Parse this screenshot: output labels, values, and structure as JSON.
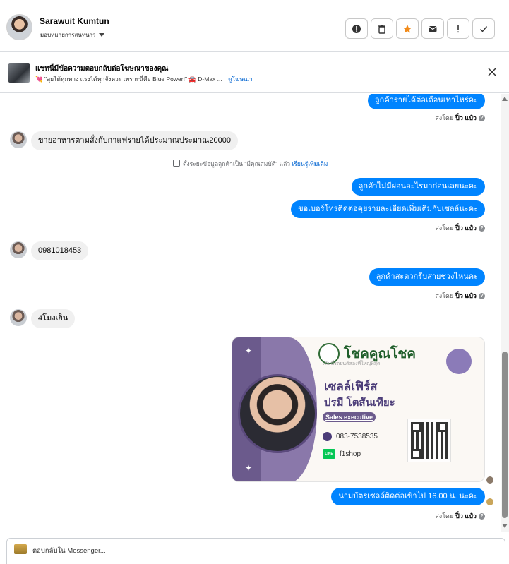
{
  "header": {
    "contact_name": "Sarawuit Kumtun",
    "assign_label": "มอบหมายการสนทนาว่"
  },
  "actions": [
    {
      "name": "spam-button",
      "icon": "alert-circle-icon"
    },
    {
      "name": "delete-button",
      "icon": "trash-icon"
    },
    {
      "name": "star-button",
      "icon": "star-icon"
    },
    {
      "name": "mark-unread-button",
      "icon": "envelope-icon"
    },
    {
      "name": "follow-up-button",
      "icon": "exclamation-icon"
    },
    {
      "name": "done-button",
      "icon": "check-icon"
    }
  ],
  "ad": {
    "title": "แชทนี้มีข้อความตอบกลับต่อโฆษณาของคุณ",
    "snippet": "💘 \"ลุยได้ทุกทาง แรงได้ทุกจังหวะ เพราะนี่คือ Blue Power!\" 🚘 D-Max ...",
    "link": "ดูโฆษณา"
  },
  "messages": {
    "m1": "ลูกค้ารายได้ต่อเดือนเท่าไหร่คะ",
    "sent1_prefix": "ส่งโดย",
    "sent1_name": "ปิ๋ว แป๋ว",
    "m2": "ขายอาหารตามสั่งกับกาแฟรายได้ประมาณประมาณ20000",
    "sys_text": "ตั้งระยะข้อมูลลูกค้าเป็น \"มีคุณสมบัติ\" แล้ว",
    "sys_link": "เรียนรู้เพิ่มเติม",
    "m3": "ลูกค้าไม่มีผ่อนอะไรมาก่อนเลยนะคะ",
    "m4": "ขอเบอร์โทรติดต่อคุยรายละเอียดเพิ่มเติมกับเซลล์นะคะ",
    "sent2_prefix": "ส่งโดย",
    "sent2_name": "ปิ๋ว แป๋ว",
    "m5": "0981018453",
    "m6": "ลูกค้าสะดวกรับสายช่วงไหนคะ",
    "sent3_prefix": "ส่งโดย",
    "sent3_name": "ปิ๋ว แป๋ว",
    "m7": "4โมงเย็น",
    "m8": "นามบัตรเซลล์ติดต่อเข้าไป 16.00  น. นะคะ",
    "sent4_prefix": "ส่งโดย",
    "sent4_name": "ปิ๋ว แป๋ว"
  },
  "card": {
    "brand": "โชคคูณโชค",
    "tagline": "เติมที่รถยนต์สองที่ใหญ่ที่สุด",
    "heading": "เซลล์เฟิร์ส",
    "person_name": "ปรมี โตสันเทียะ",
    "role": "Sales executive",
    "phone": "083-7538535",
    "line_id": "f1shop",
    "line_label": "LINE"
  },
  "composer": {
    "placeholder": "ตอบกลับใน Messenger..."
  }
}
